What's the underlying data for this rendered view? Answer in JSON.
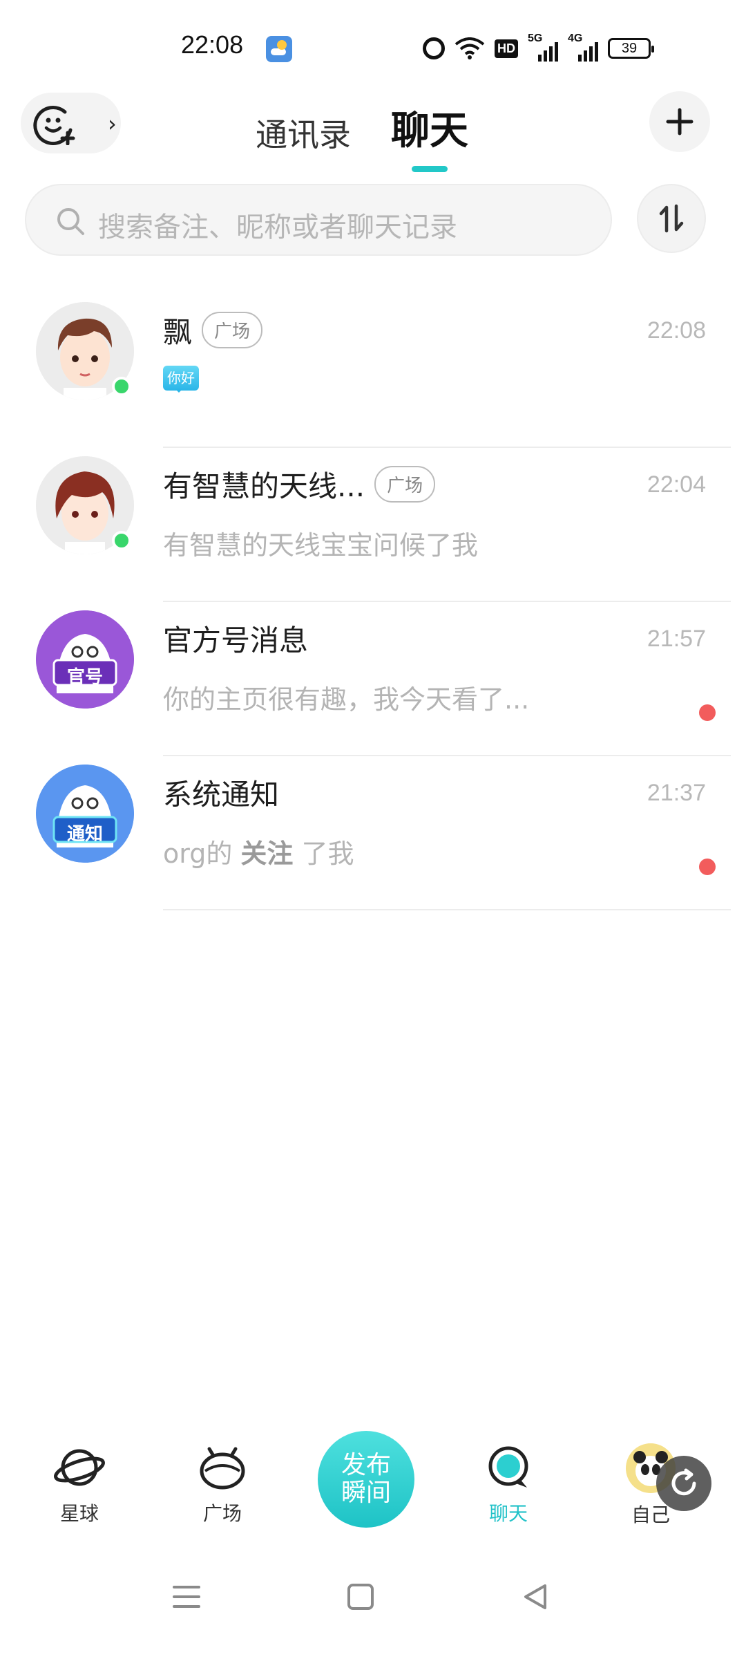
{
  "status_bar": {
    "time": "22:08",
    "network_1": "5G",
    "network_2": "4G",
    "hd": "HD",
    "battery": "39"
  },
  "header": {
    "tabs": [
      {
        "label": "通讯录",
        "active": false
      },
      {
        "label": "聊天",
        "active": true
      }
    ],
    "accent_color": "#22c8c8"
  },
  "search": {
    "placeholder": "搜索备注、昵称或者聊天记录"
  },
  "chats": [
    {
      "name": "飘",
      "tag": "广场",
      "time": "22:08",
      "sticker": "你好",
      "online": true,
      "unread": false
    },
    {
      "name": "有智慧的天线...",
      "tag": "广场",
      "time": "22:04",
      "preview": "有智慧的天线宝宝问候了我",
      "online": true,
      "unread": false
    },
    {
      "name": "官方号消息",
      "time": "21:57",
      "preview": "你的主页很有趣，我今天看了...",
      "badge": "官号",
      "unread": true
    },
    {
      "name": "系统通知",
      "time": "21:37",
      "preview_prefix": "org的 ",
      "preview_bold": "关注",
      "preview_suffix": " 了我",
      "badge": "通知",
      "unread": true
    }
  ],
  "bottom_nav": {
    "items": [
      {
        "label": "星球"
      },
      {
        "label": "广场"
      },
      {
        "label": "聊天",
        "active": true
      },
      {
        "label": "自己"
      }
    ],
    "publish_line1": "发布",
    "publish_line2": "瞬间"
  }
}
